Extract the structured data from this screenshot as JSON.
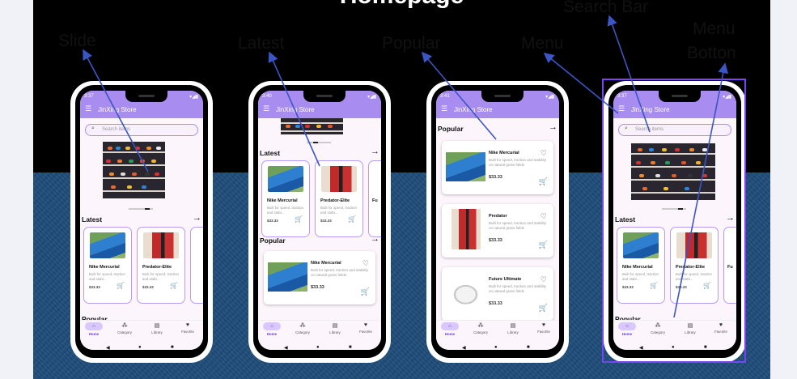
{
  "poster": {
    "title": "Homepage"
  },
  "callouts": {
    "slide": "Slide",
    "latest": "Latest",
    "popular": "Popular",
    "menu": "Menu",
    "search_bar": "Search Bar",
    "menu_button_line1": "Menu",
    "menu_button_line2": "Botton"
  },
  "app": {
    "title": "JinXing Store",
    "search_placeholder": "Search items",
    "status_times": [
      "3:37",
      "3:40",
      "3:41",
      "3:37"
    ],
    "status_right": "▾◢▮",
    "sections": {
      "latest": "Latest",
      "popular": "Popular"
    },
    "products": [
      {
        "name": "Nike Mercurial",
        "desc_short": "Built for speed, traction and stabi...",
        "desc_long": "Built for speed, traction and stability on natural grass fields",
        "price": "$33.33"
      },
      {
        "name": "Predator-Elite",
        "desc_short": "Built for speed, traction and stabi...",
        "price": "$33.33"
      },
      {
        "name": "Predator",
        "desc_long": "Built for speed, traction and stability on natural grass fields",
        "price": "$33.33"
      },
      {
        "name": "Future Ultimate",
        "desc_long": "Built for speed, traction and stability on natural grass fields",
        "price": "$33.33"
      }
    ],
    "partial_card_name": "Fu",
    "nav": [
      "Home",
      "Category",
      "Library",
      "Favorite"
    ],
    "icons": {
      "menu": "hamburger-icon",
      "search": "search-icon",
      "arrow": "arrow-right-icon",
      "heart": "heart-icon",
      "cart": "cart-icon",
      "home": "home-icon",
      "category": "category-icon",
      "library": "library-icon",
      "favorite": "favorite-icon"
    }
  },
  "colors": {
    "poster_black": "#000000",
    "poster_blue": "#1f4d7a",
    "app_purple": "#a98cf0",
    "highlight": "#7b42f6",
    "arrow_line": "#3b56c4"
  }
}
